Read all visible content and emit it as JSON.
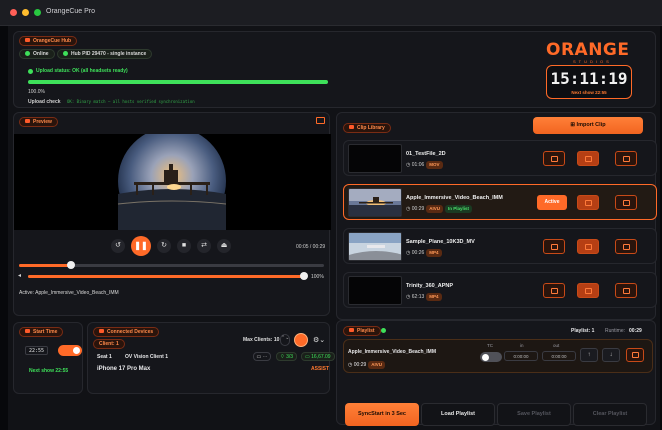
{
  "window": {
    "title": "OrangeCue Pro"
  },
  "hub": {
    "label": "OrangeCue Hub",
    "online": "Online",
    "pid": "Hub PID 29470 - single instance",
    "upload_status": "Upload status: OK (all headsets ready)",
    "progress_percent": 100,
    "progress_text": "100.0%",
    "upload_check_label": "Upload check",
    "upload_check_value": "OK: Binary match — all hosts verified synchronization"
  },
  "brand": {
    "logo": "ORANGE",
    "studios": "STUDIOS"
  },
  "clock": {
    "time": "15:11:19",
    "next_show": "Next show 22:55"
  },
  "preview": {
    "label": "Preview",
    "time": "00:05 / 00:29",
    "playback_progress": 0.17,
    "volume_percent": 100,
    "volume_text": "100%",
    "active_label": "Active: Apple_Immersive_Video_Beach_IMM"
  },
  "start_time": {
    "label": "Start Time",
    "value": "22:55",
    "next_show": "Next show 22:55",
    "enabled": true
  },
  "devices": {
    "label": "Connected Devices",
    "client_count": "Client: 1",
    "max_clients": "Max Clients: 10",
    "seat": "Seat 1",
    "client_name": "OV Vision Client 1",
    "device_model": "iPhone 17 Pro Max",
    "wifi": "3/3",
    "battery": "16,67.09",
    "role": "ASSIST"
  },
  "library": {
    "label": "Clip Library",
    "import_label": "Import Clip",
    "active_label": "Active",
    "clips": [
      {
        "name": "01_TestFile_2D",
        "duration": "01:06",
        "tags": [
          "MOV"
        ],
        "active": false
      },
      {
        "name": "Apple_Immersive_Video_Beach_IMM",
        "duration": "00:29",
        "tags": [
          "AIVU",
          "In Playlist"
        ],
        "active": true
      },
      {
        "name": "Sample_Plane_10K3D_MV",
        "duration": "00:26",
        "tags": [
          "MP4"
        ],
        "active": false
      },
      {
        "name": "Trinity_360_APNP",
        "duration": "62:13",
        "tags": [
          "MP4"
        ],
        "active": false
      }
    ]
  },
  "playlist": {
    "label": "Playlist",
    "count": "Playlist: 1",
    "runtime_label": "Runtime:",
    "runtime": "00:29",
    "item_name": "Apple_Immersive_Video_Beach_IMM",
    "item_duration": "00:29",
    "item_tag": "AIVU",
    "tc_label": "TC",
    "in_label": "in",
    "out_label": "out",
    "in_value": "0:00:00",
    "out_value": "0:00:00",
    "sync_label": "SyncStart in 3 Sec",
    "load_label": "Load Playlist",
    "save_label": "Save Playlist",
    "clear_label": "Clear Playlist"
  },
  "colors": {
    "accent": "#ff6a28",
    "ok": "#3ee05a",
    "panel": "#15161b",
    "background": "#111216"
  }
}
